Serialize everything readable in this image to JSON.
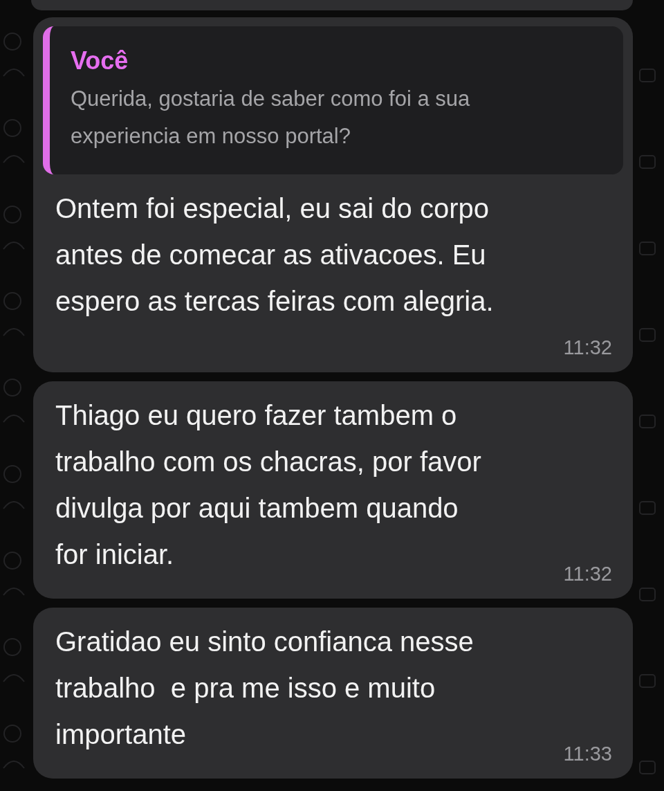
{
  "messages": [
    {
      "quote": {
        "author": "Você",
        "text": "Querida, gostaria de saber como foi a sua\nexperiencia em nosso portal?"
      },
      "text": "Ontem foi especial, eu sai do corpo\nantes de comecar as ativacoes. Eu\nespero as tercas feiras com alegria.",
      "time": "11:32"
    },
    {
      "text": "Thiago eu quero fazer tambem o\ntrabalho com os chacras, por favor\ndivulga por aqui tambem quando\nfor iniciar.",
      "time": "11:32"
    },
    {
      "text": "Gratidao eu sinto confianca nesse\ntrabalho  e pra me isso e muito\nimportante",
      "time": "11:33"
    }
  ]
}
